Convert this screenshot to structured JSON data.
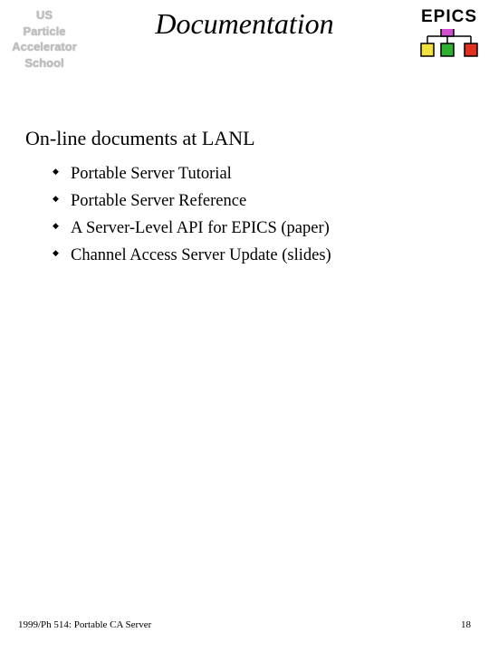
{
  "logo_left": {
    "line1": "US",
    "line2": "Particle",
    "line3": "Accelerator",
    "line4": "School"
  },
  "title": "Documentation",
  "epics_label": "EPICS",
  "section_heading": "On-line documents at LANL",
  "bullets": [
    "Portable Server Tutorial",
    "Portable Server Reference",
    "A Server-Level API for EPICS (paper)",
    "Channel Access Server Update (slides)"
  ],
  "footer_left": "1999/Ph 514: Portable CA Server",
  "footer_right": "18"
}
